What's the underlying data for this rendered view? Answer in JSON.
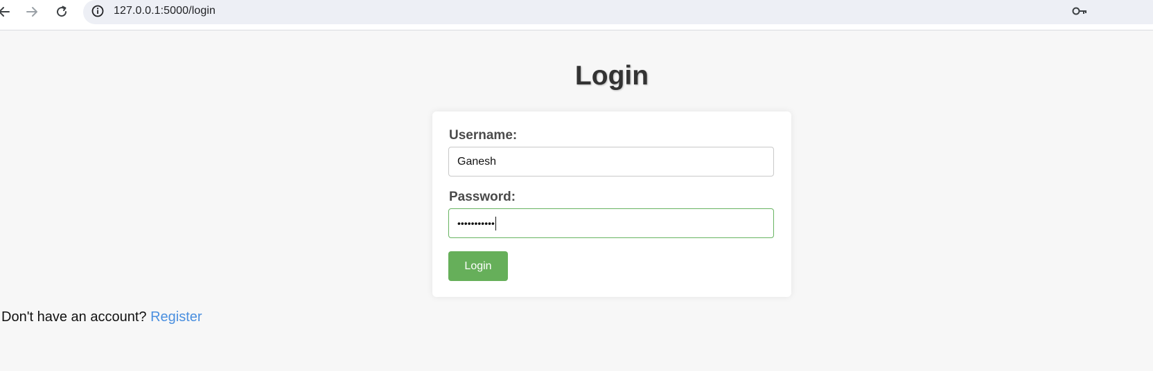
{
  "browser": {
    "url": "127.0.0.1:5000/login",
    "back_icon": "arrow-left-icon",
    "forward_icon": "arrow-right-icon",
    "reload_icon": "reload-icon",
    "site_info_icon": "info-icon",
    "password_manager_icon": "key-icon"
  },
  "page": {
    "title": "Login",
    "username_label": "Username:",
    "username_value": "Ganesh",
    "password_label": "Password:",
    "password_masked": "•••••••••••",
    "login_button": "Login",
    "footer_text": "Don't have an account?",
    "register_link": "Register"
  },
  "colors": {
    "page_background": "#f7f7f7",
    "button_green": "#66af5a",
    "focus_border": "#66b360",
    "link_blue": "#4a8fdf",
    "heading": "#333333"
  }
}
